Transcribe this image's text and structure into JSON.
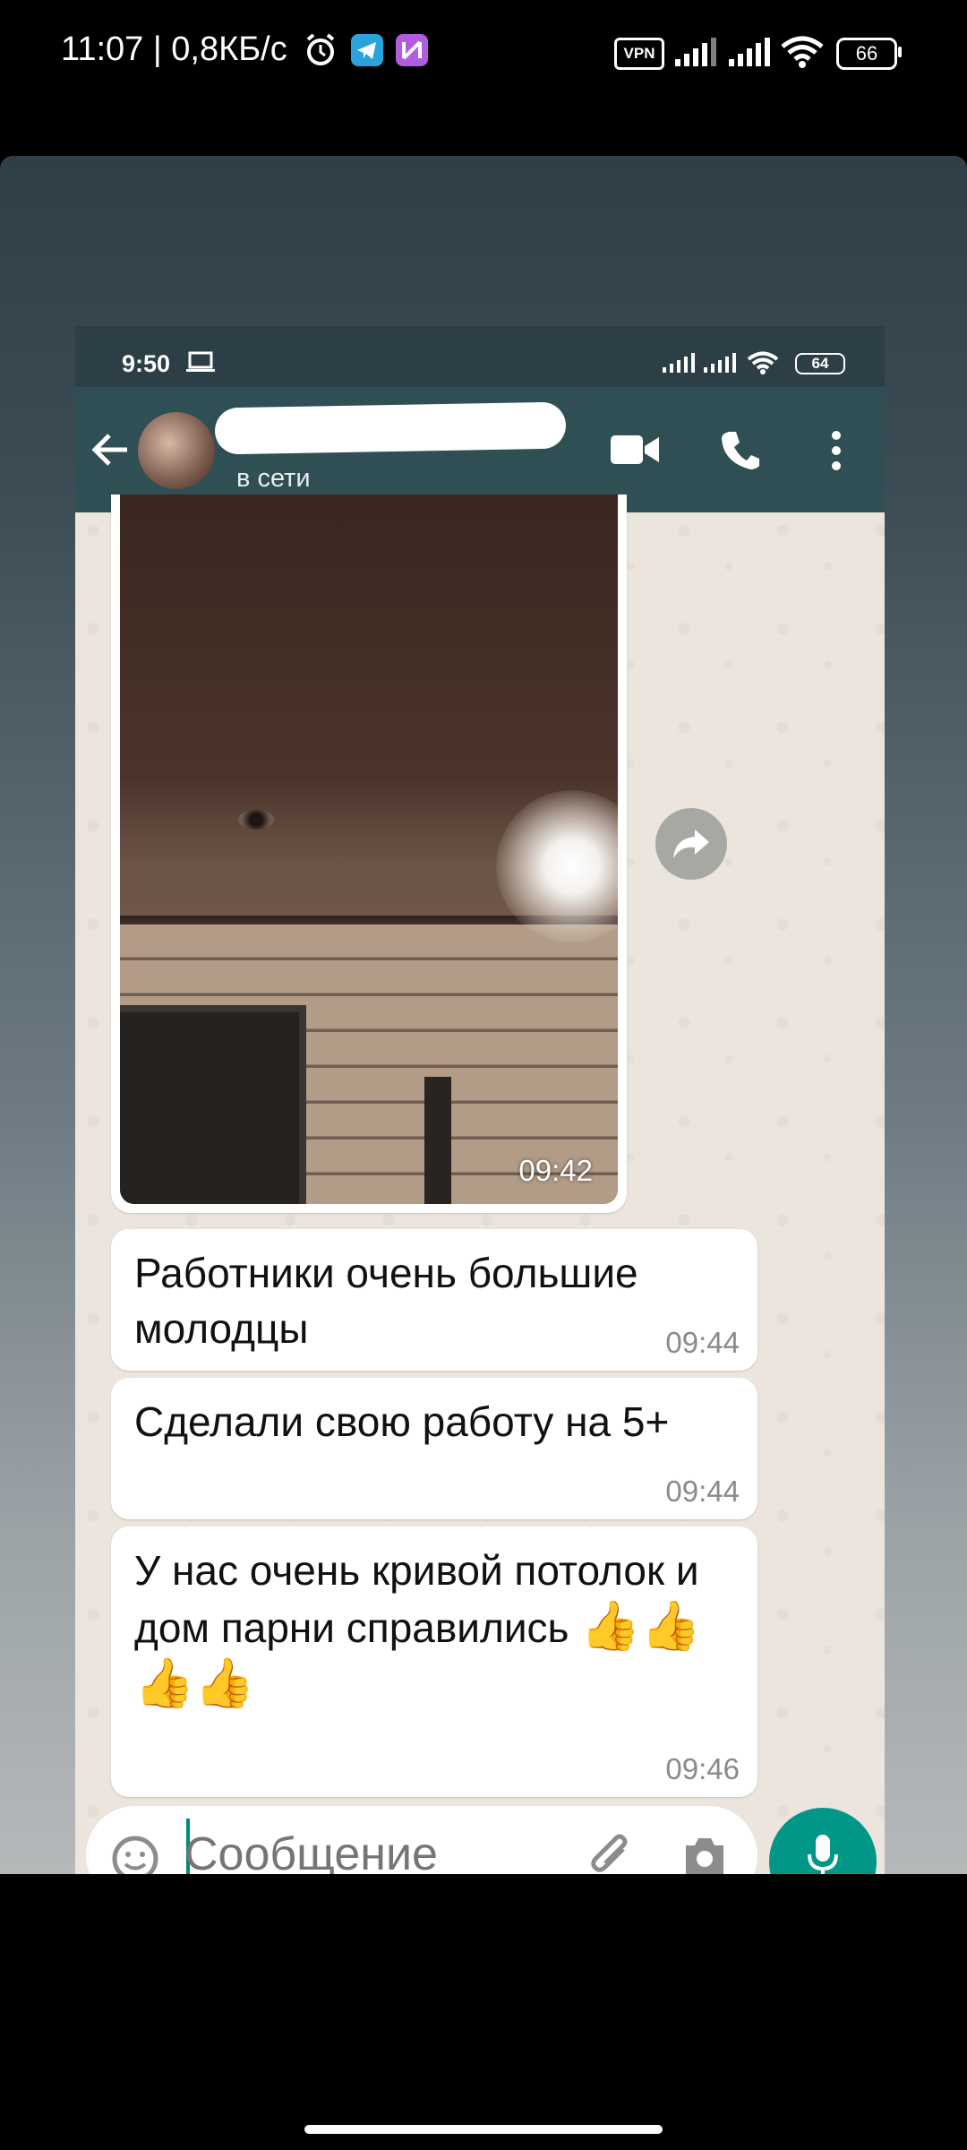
{
  "outer_status": {
    "time": "11:07",
    "speed": "| 0,8КБ/с",
    "vpn": "VPN",
    "battery": "66",
    "icons": [
      "alarm-icon",
      "telegram-icon",
      "app-icon",
      "signal-icon",
      "signal-icon",
      "wifi-icon"
    ]
  },
  "inner_status": {
    "time": "9:50",
    "battery": "64",
    "icons": [
      "laptop-icon",
      "signal-icon",
      "signal-icon",
      "wifi-icon"
    ]
  },
  "chat_header": {
    "status": "в сети",
    "icons": [
      "back-arrow-icon",
      "video-call-icon",
      "phone-icon",
      "more-vert-icon"
    ]
  },
  "messages": [
    {
      "type": "media",
      "time": "09:42"
    },
    {
      "type": "text",
      "text": "Работники очень большие молодцы",
      "time": "09:44"
    },
    {
      "type": "text",
      "text": "Сделали свою работу на 5+",
      "time": "09:44"
    },
    {
      "type": "text",
      "text": "У нас очень кривой потолок и дом парни справились",
      "emoji": "👍👍👍👍",
      "time": "09:46"
    }
  ],
  "composer": {
    "placeholder": "Сообщение",
    "icons": [
      "emoji-icon",
      "attach-icon",
      "camera-icon",
      "mic-icon"
    ]
  },
  "colors": {
    "header": "#2f4f55",
    "accent": "#009688",
    "chat_bg": "#ece5dd"
  }
}
